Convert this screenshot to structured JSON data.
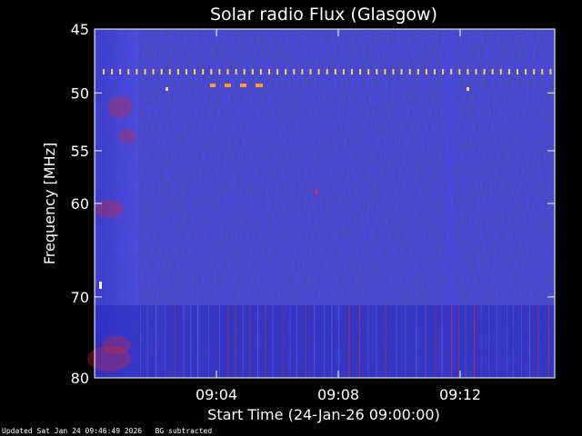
{
  "chart_data": {
    "type": "heatmap",
    "title": "Solar radio Flux (Glasgow)",
    "xlabel": "Start Time (24-Jan-26 09:00:00)",
    "ylabel": "Frequency [MHz]",
    "x_ticks": [
      "09:04",
      "09:08",
      "09:12"
    ],
    "y_ticks": [
      45,
      50,
      55,
      60,
      70,
      80
    ],
    "ylim": [
      45,
      80
    ],
    "y_scale": "log",
    "grid": false,
    "colors": {
      "background": "#000000",
      "spectrum_base": "#1a1aa8",
      "spectrum_light": "#3a3ae0",
      "burst": "#ff3010",
      "marker": "#ffd060",
      "axis": "#ffffff"
    }
  },
  "footer": {
    "updated": "Updated Sat Jan 24 09:46:49 2026",
    "mode": "BG subtracted"
  }
}
